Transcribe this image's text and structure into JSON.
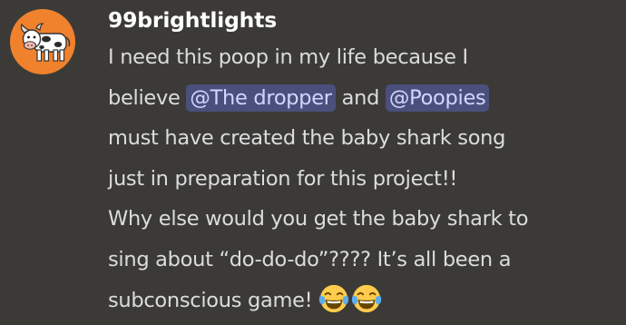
{
  "message": {
    "author": "99brightlights",
    "lines": [
      {
        "segments": [
          {
            "type": "text",
            "text": "I need this poop in my life because I"
          }
        ]
      },
      {
        "segments": [
          {
            "type": "text",
            "text": "believe "
          },
          {
            "type": "mention",
            "text": "@The dropper"
          },
          {
            "type": "text",
            "text": " and "
          },
          {
            "type": "mention",
            "text": "@Poopies"
          }
        ]
      },
      {
        "segments": [
          {
            "type": "text",
            "text": "must have created the baby shark song"
          }
        ]
      },
      {
        "segments": [
          {
            "type": "text",
            "text": "just in preparation for this project!!"
          }
        ]
      },
      {
        "segments": [
          {
            "type": "text",
            "text": "Why else would you get the baby shark to"
          }
        ]
      },
      {
        "segments": [
          {
            "type": "text",
            "text": "sing about “do-do-do”???? It’s all been a"
          }
        ]
      },
      {
        "segments": [
          {
            "type": "text",
            "text": "subconscious game! "
          },
          {
            "type": "emoji",
            "icon": "joy-emoji-icon"
          },
          {
            "type": "emoji",
            "icon": "joy-emoji-icon"
          }
        ]
      }
    ]
  },
  "avatar": {
    "icon": "cow-avatar-icon",
    "background": "#f0812d"
  },
  "colors": {
    "background": "#3b3a37",
    "text": "#dcddde",
    "username": "#ffffff",
    "mention_bg": "#4b4f7c",
    "mention_text": "#d3d7ff"
  }
}
